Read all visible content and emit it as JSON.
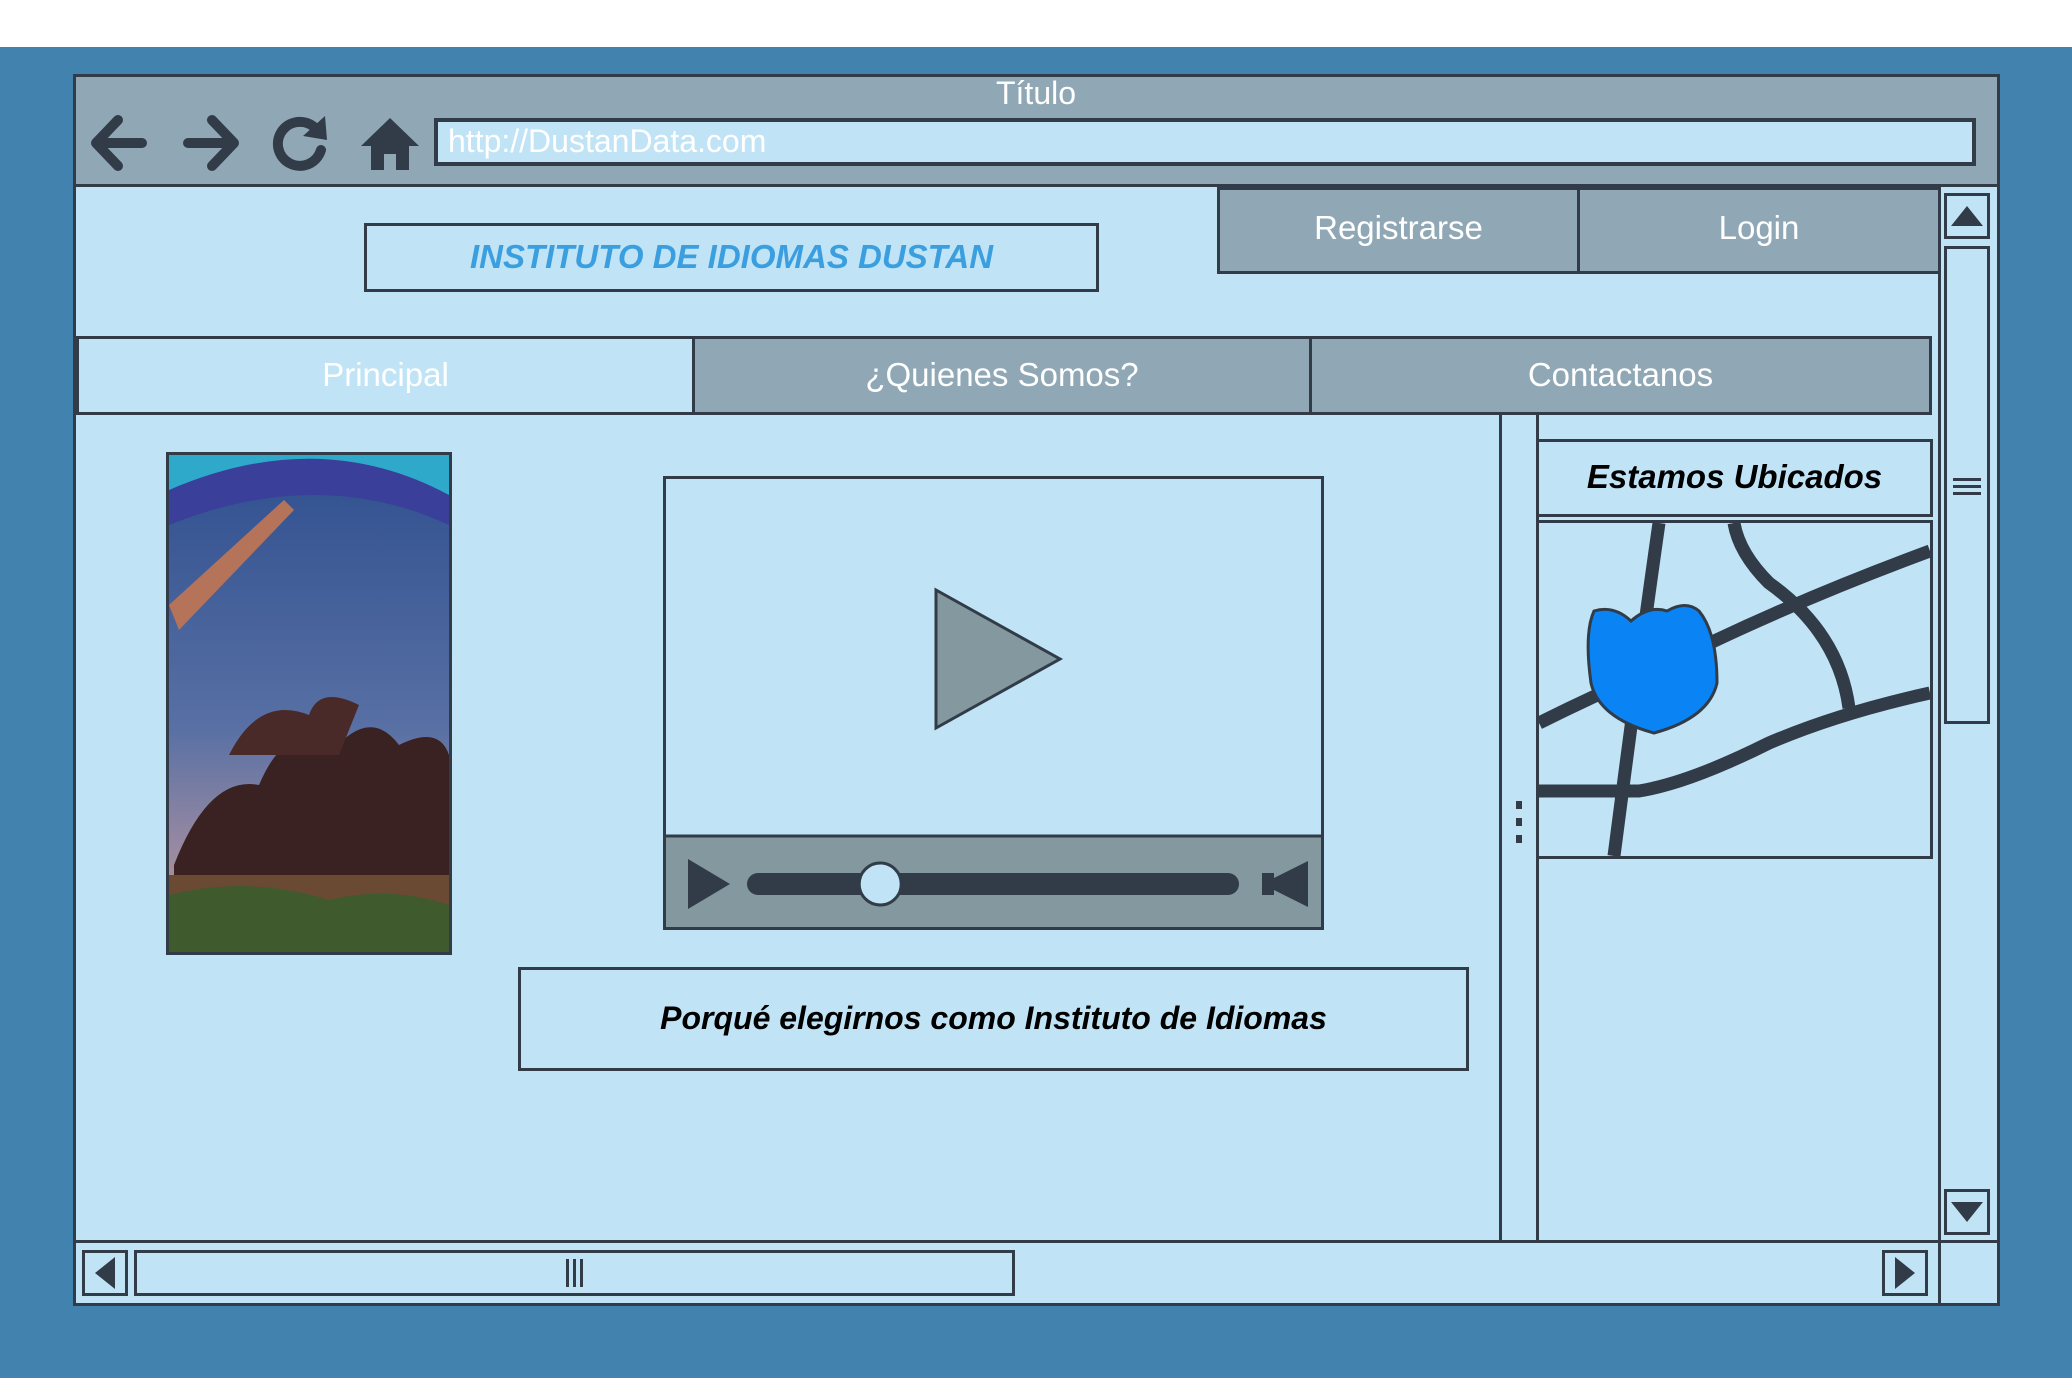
{
  "window": {
    "title": "Título",
    "url": "http://DustanData.com"
  },
  "toolbar": {
    "back_icon": "arrow-left-icon",
    "forward_icon": "arrow-right-icon",
    "reload_icon": "reload-icon",
    "home_icon": "home-icon"
  },
  "header": {
    "logo_text": "INSTITUTO DE IDIOMAS DUSTAN",
    "register_label": "Registrarse",
    "login_label": "Login"
  },
  "nav": {
    "tabs": [
      {
        "label": "Principal",
        "active": true
      },
      {
        "label": "¿Quienes Somos?",
        "active": false
      },
      {
        "label": "Contactanos",
        "active": false
      }
    ]
  },
  "main": {
    "video": {
      "progress": 0.26
    },
    "caption": "Porqué elegirnos como Instituto de Idiomas"
  },
  "sidebar": {
    "location_title": "Estamos Ubicados"
  },
  "colors": {
    "backdrop": "#4282ae",
    "page": "#c0e4f6",
    "chrome": "#90a8b5",
    "border": "#323c48",
    "logo_text": "#3b9fdf",
    "map_marker": "#0a84f5",
    "video_gray": "#83989f"
  }
}
